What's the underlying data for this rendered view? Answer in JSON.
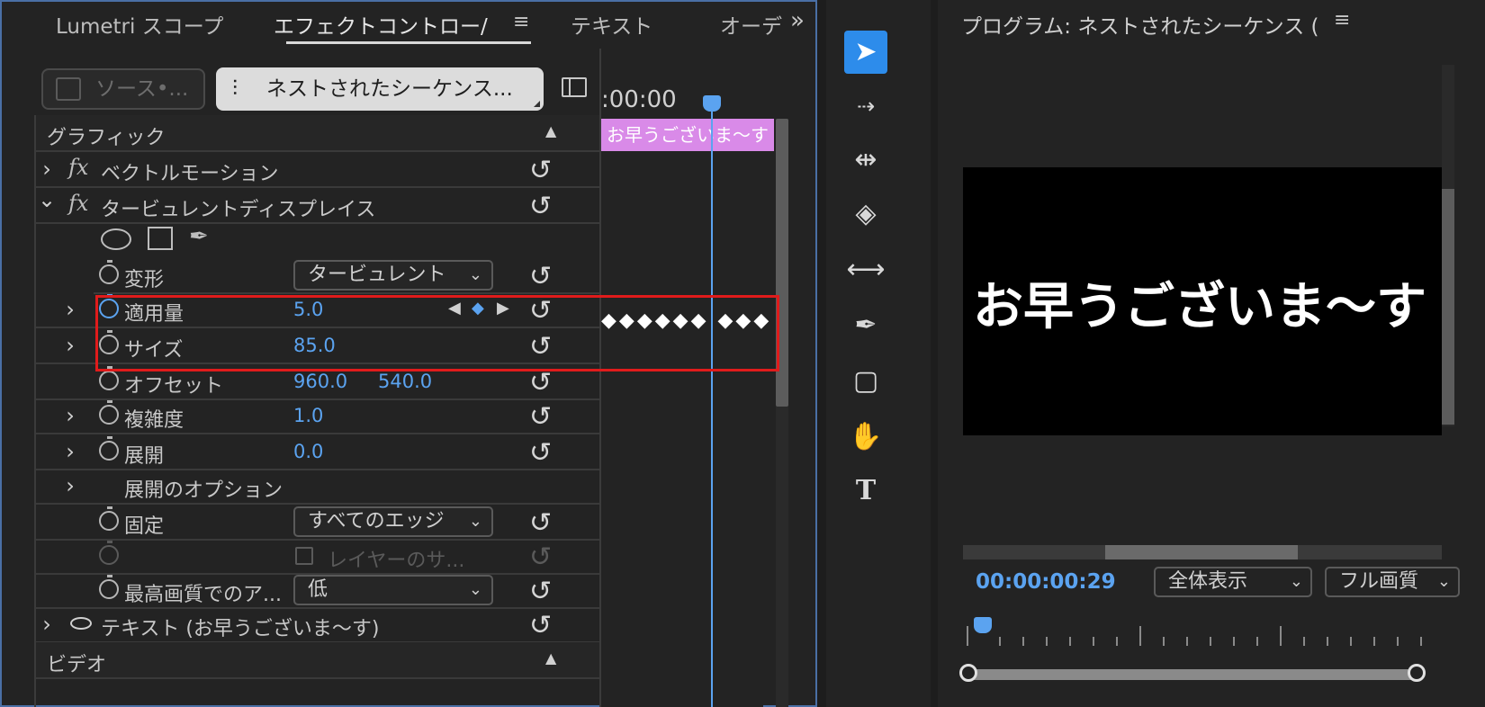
{
  "effect_controls": {
    "tabs": [
      "Lumetri スコープ",
      "エフェクトコントロー/",
      "テキスト",
      "オーデ"
    ],
    "source_button": "ソース•...",
    "sequence_button": "ネストされたシーケンス...",
    "timeline": {
      "timecode": ":00:00",
      "clip_label": "お早うございま～す",
      "keyframes": "◆◆◆◆◆◆ ◆◆◆"
    },
    "sections": {
      "graphic": "グラフィック",
      "vector_motion": "ベクトルモーション",
      "turbulent_displace": "タービュレントディスプレイス",
      "text_layer": "テキスト (お早うございま～す)",
      "video": "ビデオ"
    },
    "properties": {
      "displacement": {
        "label": "変形",
        "value": "タービュレント"
      },
      "amount": {
        "label": "適用量",
        "value": "5.0"
      },
      "size": {
        "label": "サイズ",
        "value": "85.0"
      },
      "offset": {
        "label": "オフセット",
        "x": "960.0",
        "y": "540.0"
      },
      "complexity": {
        "label": "複雑度",
        "value": "1.0"
      },
      "evolution": {
        "label": "展開",
        "value": "0.0"
      },
      "evolution_options": {
        "label": "展開のオプション"
      },
      "pinning": {
        "label": "固定",
        "value": "すべてのエッジ"
      },
      "resize_layer": {
        "label": "レイヤーのサ..."
      },
      "antialias": {
        "label": "最高画質でのア...",
        "value": "低"
      }
    },
    "icons": {
      "reset": "↺",
      "chevron_right": "›",
      "chevron_down": "⌄",
      "collapse": "▲",
      "menu": "≡",
      "overflow": "»",
      "fx": "fx",
      "eye": "👁"
    }
  },
  "tools": [
    "selection-tool",
    "track-select-tool",
    "ripple-edit-tool",
    "razor-tool",
    "slip-tool",
    "pen-tool",
    "rectangle-tool",
    "hand-tool",
    "type-tool"
  ],
  "program_monitor": {
    "title": "プログラム: ネストされたシーケンス (",
    "caption": "お早うございま～す",
    "timecode": "00:00:00:29",
    "zoom_select": "全体表示",
    "quality_select": "フル画質"
  },
  "colors": {
    "accent": "#5ba3f0",
    "clip": "#d98ae8",
    "highlight": "#e01b1b",
    "selected_tool": "#2d8ceb"
  }
}
